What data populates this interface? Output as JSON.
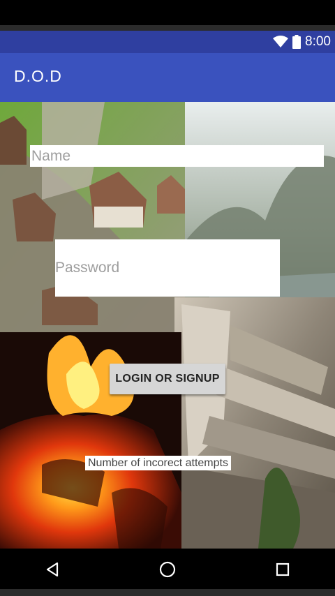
{
  "status_bar": {
    "time": "8:00",
    "icons": [
      "wifi-icon",
      "battery-icon"
    ],
    "color": "#2f3fa0"
  },
  "app_bar": {
    "title": "D.O.D",
    "color": "#3a52be"
  },
  "form": {
    "name_placeholder": "Name",
    "password_placeholder": "Password",
    "login_label": "LOGIN OR SIGNUP",
    "attempts_text": "Number of incorect attempts"
  },
  "nav_bar": {
    "buttons": [
      "back-icon",
      "home-icon",
      "recents-icon"
    ]
  }
}
